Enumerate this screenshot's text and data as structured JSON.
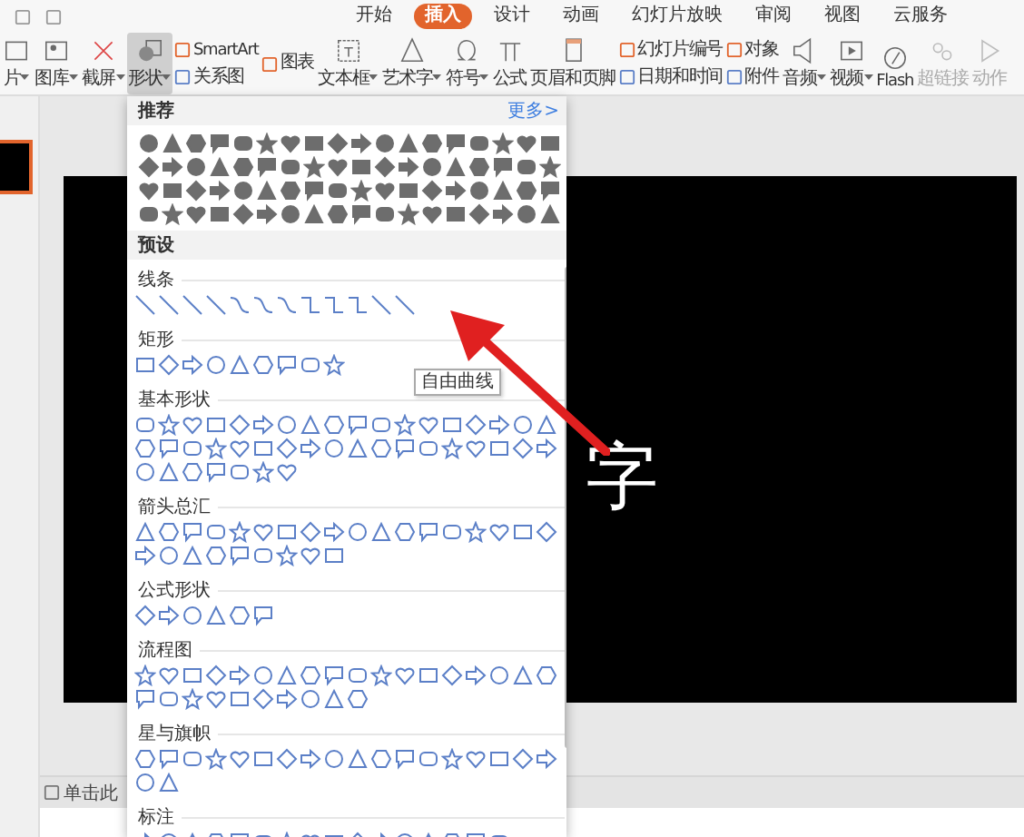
{
  "menu_tabs": [
    {
      "label": "开始",
      "selected": false
    },
    {
      "label": "插入",
      "selected": true
    },
    {
      "label": "设计",
      "selected": false
    },
    {
      "label": "动画",
      "selected": false
    },
    {
      "label": "幻灯片放映",
      "selected": false
    },
    {
      "label": "审阅",
      "selected": false
    },
    {
      "label": "视图",
      "selected": false
    },
    {
      "label": "云服务",
      "selected": false
    }
  ],
  "toolbar": [
    {
      "kind": "large",
      "label": "片",
      "dropdown": true,
      "selected": false,
      "disabled": false
    },
    {
      "kind": "large",
      "label": "图库",
      "dropdown": true,
      "selected": false,
      "disabled": false
    },
    {
      "kind": "large",
      "label": "截屏",
      "dropdown": true,
      "selected": false,
      "disabled": false
    },
    {
      "kind": "large",
      "label": "形状",
      "dropdown": true,
      "selected": true,
      "disabled": false
    },
    {
      "kind": "pair",
      "items": [
        {
          "label": "SmartArt"
        },
        {
          "label": "关系图"
        }
      ]
    },
    {
      "kind": "pair",
      "items": [
        {
          "label": "图表"
        }
      ]
    },
    {
      "kind": "large",
      "label": "文本框",
      "dropdown": true,
      "selected": false,
      "disabled": false
    },
    {
      "kind": "large",
      "label": "艺术字",
      "dropdown": true,
      "selected": false,
      "disabled": false
    },
    {
      "kind": "large",
      "label": "符号",
      "dropdown": true,
      "selected": false,
      "disabled": false
    },
    {
      "kind": "large",
      "label": "公式",
      "dropdown": false,
      "selected": false,
      "disabled": false
    },
    {
      "kind": "large",
      "label": "页眉和页脚",
      "dropdown": false,
      "selected": false,
      "disabled": false
    },
    {
      "kind": "pair",
      "items": [
        {
          "label": "幻灯片编号"
        },
        {
          "label": "日期和时间"
        }
      ]
    },
    {
      "kind": "pair",
      "items": [
        {
          "label": "对象"
        },
        {
          "label": "附件"
        }
      ]
    },
    {
      "kind": "large",
      "label": "音频",
      "dropdown": true,
      "selected": false,
      "disabled": false
    },
    {
      "kind": "large",
      "label": "视频",
      "dropdown": true,
      "selected": false,
      "disabled": false
    },
    {
      "kind": "large",
      "label": "Flash",
      "dropdown": false,
      "selected": false,
      "disabled": false
    },
    {
      "kind": "large",
      "label": "超链接",
      "dropdown": false,
      "selected": false,
      "disabled": true
    },
    {
      "kind": "large",
      "label": "动作",
      "dropdown": false,
      "selected": false,
      "disabled": true
    }
  ],
  "slide": {
    "text": "字"
  },
  "notes": {
    "placeholder": "单击此"
  },
  "shape_panel": {
    "header": "推荐",
    "more_link": "更多>",
    "preset_header": "预设",
    "groups": [
      {
        "title": "线条"
      },
      {
        "title": "矩形"
      },
      {
        "title": "基本形状"
      },
      {
        "title": "箭头总汇"
      },
      {
        "title": "公式形状"
      },
      {
        "title": "流程图"
      },
      {
        "title": "星与旗帜"
      },
      {
        "title": "标注"
      }
    ]
  },
  "tooltip": {
    "text": "自由曲线"
  }
}
